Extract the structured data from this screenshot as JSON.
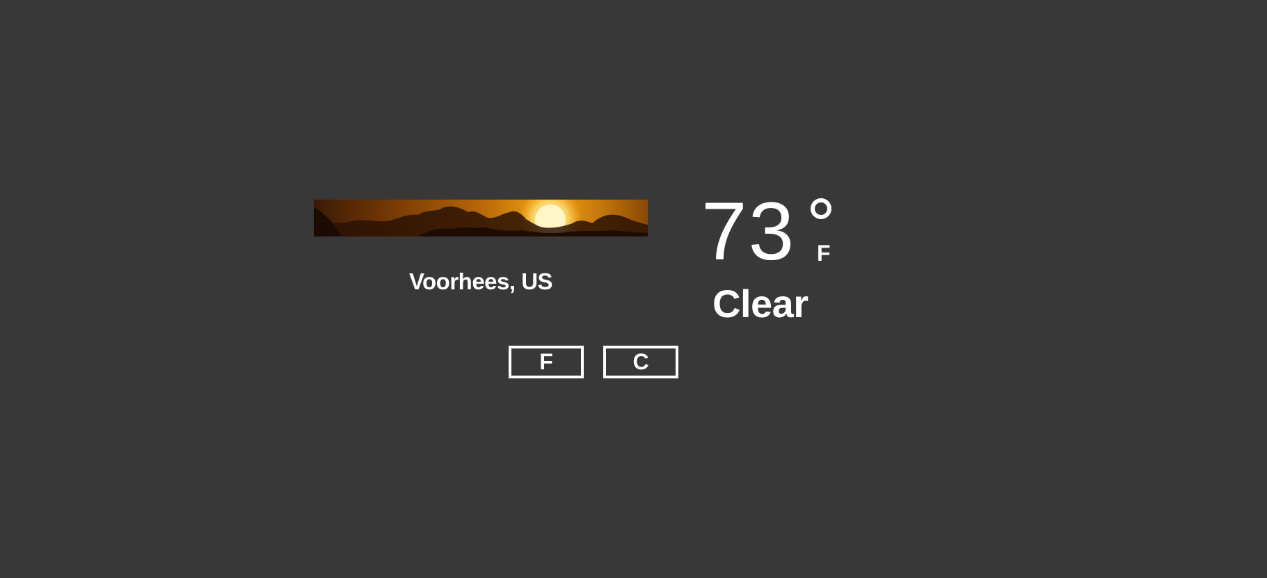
{
  "weather": {
    "location": "Voorhees, US",
    "temperature": "73",
    "unit": "F",
    "condition": "Clear"
  },
  "units": {
    "fahrenheit_label": "F",
    "celsius_label": "C"
  },
  "icons": {
    "degree": "degree-symbol-icon",
    "banner": "sunset-banner-image"
  },
  "colors": {
    "background": "#383838",
    "text": "#ffffff",
    "sky_light": "#f2a416",
    "sky_dark": "#7a3c06"
  }
}
